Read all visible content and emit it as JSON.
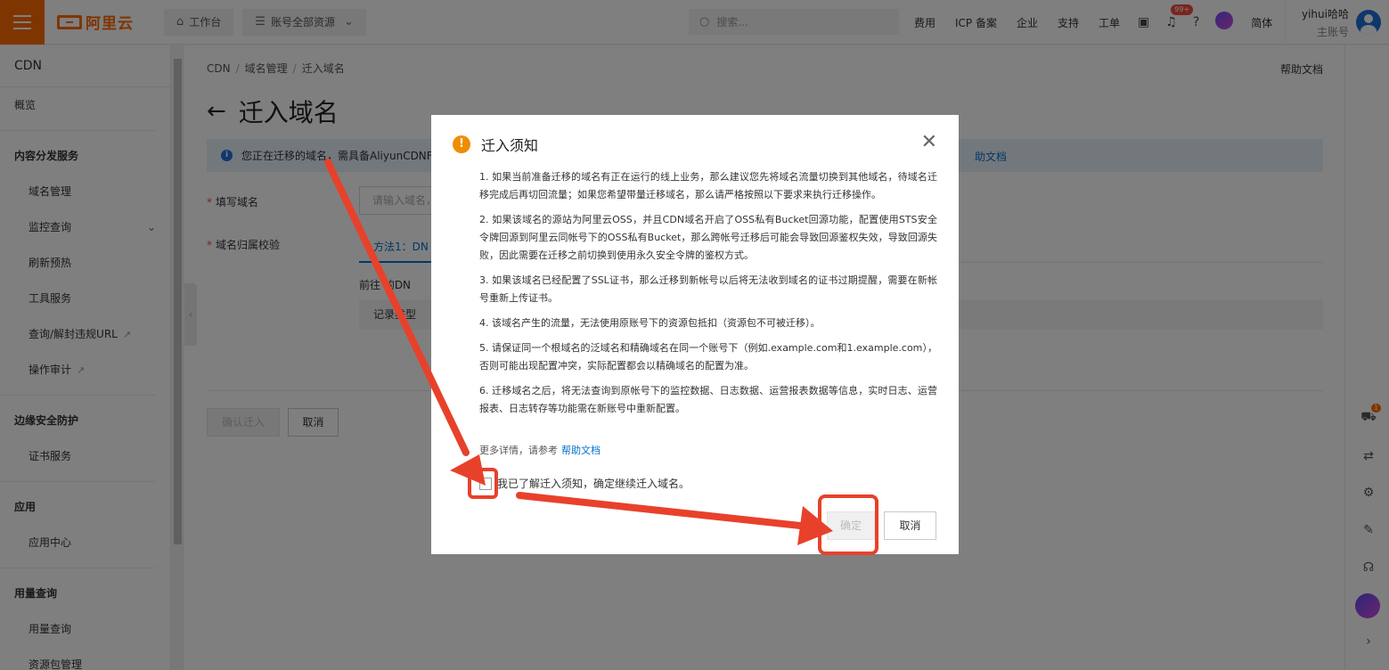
{
  "topbar": {
    "brand": "阿里云",
    "workbench": "工作台",
    "resources": "账号全部资源",
    "search_placeholder": "搜索...",
    "links": [
      "费用",
      "ICP 备案",
      "企业",
      "支持",
      "工单"
    ],
    "notif_badge": "99+",
    "lang": "简体",
    "user_name": "yihui哈哈",
    "user_role": "主账号",
    "accent_color": "#ff6a00"
  },
  "sidebar": {
    "title": "CDN",
    "overview": "概览",
    "group_content": "内容分发服务",
    "domain_mgmt": "域名管理",
    "monitor": "监控查询",
    "refresh": "刷新预热",
    "tools": "工具服务",
    "query_url": "查询/解封违规URL",
    "audit": "操作审计",
    "group_security": "边缘安全防护",
    "cert": "证书服务",
    "group_app": "应用",
    "app_center": "应用中心",
    "group_usage": "用量查询",
    "usage_query": "用量查询",
    "resource_pkg": "资源包管理"
  },
  "main": {
    "breadcrumb": [
      "CDN",
      "域名管理",
      "迁入域名"
    ],
    "help_doc": "帮助文档",
    "title": "迁入域名",
    "info_text": "您正在迁移的域名，需具备AliyunCDNFu",
    "info_link": "助文档",
    "label_domain": "填写域名",
    "domain_placeholder": "请输入域名，",
    "label_verify": "域名归属校验",
    "method_tab": "方法1：DN",
    "method_desc": "前往 的DN",
    "record_type": "记录类型",
    "confirm_migrate": "确认迁入",
    "cancel": "取消"
  },
  "modal": {
    "title": "迁入须知",
    "items": [
      "1. 如果当前准备迁移的域名有正在运行的线上业务，那么建议您先将域名流量切换到其他域名，待域名迁移完成后再切回流量；如果您希望带量迁移域名，那么请严格按照以下要求来执行迁移操作。",
      "2. 如果该域名的源站为阿里云OSS，并且CDN域名开启了OSS私有Bucket回源功能，配置使用STS安全令牌回源到阿里云同帐号下的OSS私有Bucket，那么跨帐号迁移后可能会导致回源鉴权失效，导致回源失败，因此需要在迁移之前切换到使用永久安全令牌的鉴权方式。",
      "3. 如果该域名已经配置了SSL证书，那么迁移到新帐号以后将无法收到域名的证书过期提醒，需要在新帐号重新上传证书。",
      "4. 该域名产生的流量，无法使用原账号下的资源包抵扣（资源包不可被迁移）。",
      "5. 请保证同一个根域名的泛域名和精确域名在同一个账号下（例如.example.com和1.example.com），否则可能出现配置冲突，实际配置都会以精确域名的配置为准。",
      "6. 迁移域名之后，将无法查询到原帐号下的监控数据、日志数据、运营报表数据等信息，实时日志、运营报表、日志转存等功能需在新账号中重新配置。"
    ],
    "more_info": "更多详情，请参考",
    "more_link": "帮助文档",
    "ack": "我已了解迁入须知，确定继续迁入域名。",
    "ok": "确定",
    "cancel": "取消"
  },
  "rail": {
    "cart_badge": "1"
  }
}
